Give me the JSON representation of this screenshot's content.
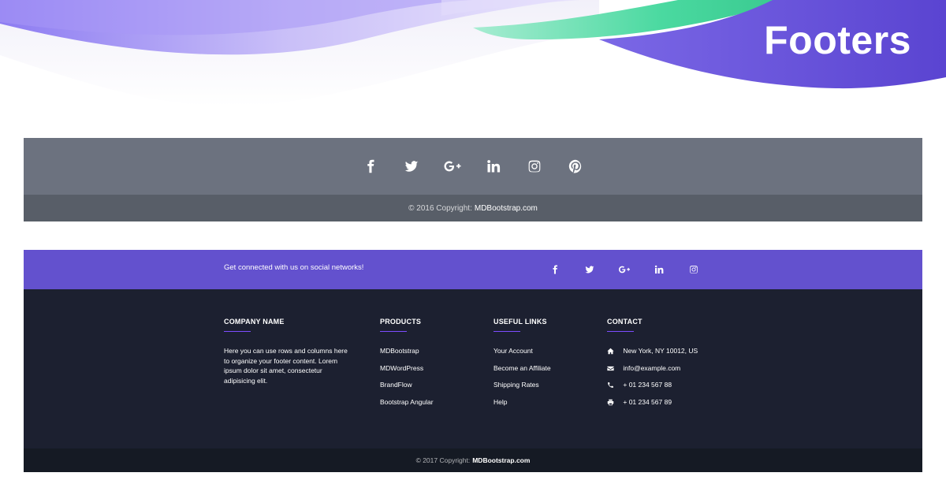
{
  "hero": {
    "title": "Footers"
  },
  "colors": {
    "purple": "#6351ce",
    "dark": "#1c2030",
    "gray": "#6c727f",
    "green": "#4ad9a0",
    "accent": "#7c4dff"
  },
  "footer1": {
    "social_icons": [
      "facebook-icon",
      "twitter-icon",
      "google-plus-icon",
      "linkedin-icon",
      "instagram-icon",
      "pinterest-icon"
    ],
    "copyright_prefix": "© 2016 Copyright:",
    "copyright_link": "MDBootstrap.com"
  },
  "footer2": {
    "tagline": "Get connected with us on social networks!",
    "social_icons": [
      "facebook-icon",
      "twitter-icon",
      "google-plus-icon",
      "linkedin-icon",
      "instagram-icon"
    ],
    "company": {
      "heading": "COMPANY NAME",
      "text": "Here you can use rows and columns here to organize your footer content. Lorem ipsum dolor sit amet, consectetur adipisicing elit."
    },
    "products": {
      "heading": "PRODUCTS",
      "items": [
        "MDBootstrap",
        "MDWordPress",
        "BrandFlow",
        "Bootstrap Angular"
      ]
    },
    "useful_links": {
      "heading": "USEFUL LINKS",
      "items": [
        "Your Account",
        "Become an Affiliate",
        "Shipping Rates",
        "Help"
      ]
    },
    "contact": {
      "heading": "CONTACT",
      "items": [
        {
          "icon": "home-icon",
          "text": "New York, NY 10012, US"
        },
        {
          "icon": "envelope-icon",
          "text": "info@example.com"
        },
        {
          "icon": "phone-icon",
          "text": "+ 01 234 567 88"
        },
        {
          "icon": "print-icon",
          "text": "+ 01 234 567 89"
        }
      ]
    },
    "copyright_prefix": "© 2017 Copyright:",
    "copyright_link": "MDBootstrap.com"
  }
}
